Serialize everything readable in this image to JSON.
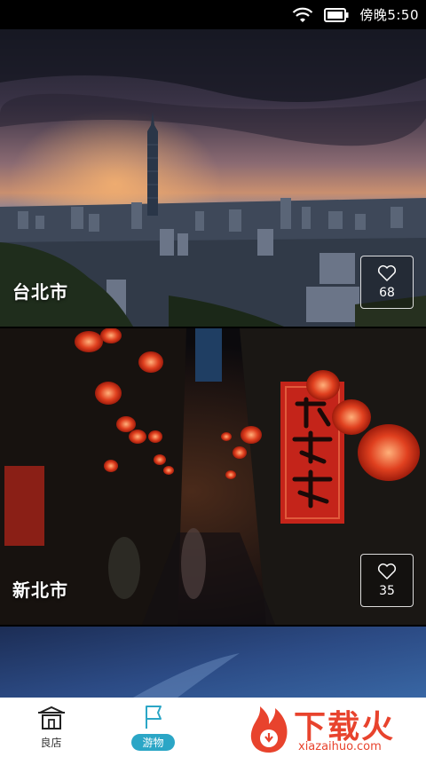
{
  "status_bar": {
    "time": "傍晚5:50",
    "icons": [
      "wifi-icon",
      "battery-icon"
    ]
  },
  "cards": [
    {
      "name": "台北市",
      "likes": "68",
      "icon": "heart-icon"
    },
    {
      "name": "新北市",
      "likes": "35",
      "icon": "heart-icon"
    },
    {
      "name": "",
      "likes": "",
      "icon": ""
    }
  ],
  "bottom_nav": {
    "items": [
      {
        "label": "良店",
        "icon": "shop-icon",
        "active": false
      },
      {
        "label": "游物",
        "icon": "bookmark-icon",
        "active": true
      }
    ],
    "accent": "#2ba6c6"
  },
  "watermark": {
    "title": "下载火",
    "url": "xiazaihuo.com",
    "color": "#e8432d"
  }
}
